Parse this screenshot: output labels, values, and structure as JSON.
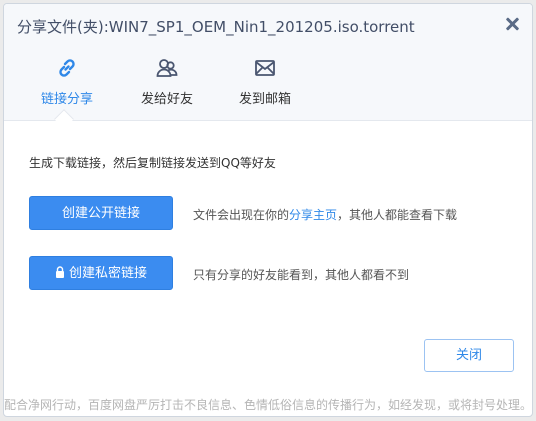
{
  "dialog": {
    "title": "分享文件(夹):WIN7_SP1_OEM_Nin1_201205.iso.torrent"
  },
  "tabs": [
    {
      "label": "链接分享",
      "icon": "link-icon",
      "active": true
    },
    {
      "label": "发给好友",
      "icon": "friends-icon",
      "active": false
    },
    {
      "label": "发到邮箱",
      "icon": "mail-icon",
      "active": false
    }
  ],
  "content": {
    "description": "生成下载链接，然后复制链接发送到QQ等好友",
    "public_button": "创建公开链接",
    "public_note_prefix": "文件会出现在你的",
    "public_note_link": "分享主页",
    "public_note_suffix": "，其他人都能查看下载",
    "private_button": "创建私密链接",
    "private_note": "只有分享的好友能看到，其他人都看不到"
  },
  "footer": {
    "close_button": "关闭",
    "notice": "配合净网行动，百度网盘严厉打击不良信息、色情低俗信息的传播行为，如经发现，或将封号处理。"
  },
  "colors": {
    "accent": "#2f88e8",
    "button_blue": "#3b8cf0",
    "header_bg": "#f6f8fb"
  }
}
